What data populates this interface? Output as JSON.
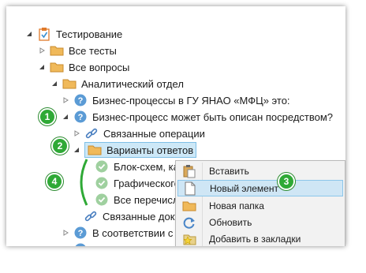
{
  "tree": [
    {
      "label": "Тестирование",
      "icon": "clipboard-check-icon",
      "arrow": "expanded"
    },
    {
      "label": "Все тесты",
      "icon": "folder-icon",
      "arrow": "collapsed"
    },
    {
      "label": "Все вопросы",
      "icon": "folder-icon",
      "arrow": "expanded"
    },
    {
      "label": "Аналитический отдел",
      "icon": "folder-icon",
      "arrow": "expanded"
    },
    {
      "label": "Бизнес-процессы в ГУ ЯНАО «МФЦ» это:",
      "icon": "question-icon",
      "arrow": "collapsed"
    },
    {
      "label": "Бизнес-процесс может быть описан посредством?",
      "icon": "question-icon",
      "arrow": "expanded"
    },
    {
      "label": "Связанные операции",
      "icon": "link-icon",
      "arrow": "collapsed"
    },
    {
      "label": "Варианты ответов",
      "icon": "folder-icon",
      "arrow": "expanded"
    },
    {
      "label": "Блок-схем, кар",
      "icon": "check-circle-icon",
      "arrow": "none"
    },
    {
      "label": "Графического",
      "icon": "check-circle-icon",
      "arrow": "none"
    },
    {
      "label": "Все перечисле",
      "icon": "check-circle-icon",
      "arrow": "none"
    },
    {
      "label": "Связанные докум",
      "icon": "link-icon",
      "arrow": "none"
    },
    {
      "label": "В соответствии с че",
      "icon": "question-icon",
      "arrow": "collapsed"
    },
    {
      "label": "",
      "icon": "question-icon",
      "arrow": "collapsed"
    }
  ],
  "context_menu": [
    {
      "label": "Вставить",
      "icon": "paste-icon"
    },
    {
      "label": "Новый элемент",
      "icon": "new-document-icon"
    },
    {
      "label": "Новая папка",
      "icon": "folder-icon"
    },
    {
      "label": "Обновить",
      "icon": "refresh-icon"
    },
    {
      "label": "Добавить в закладки",
      "icon": "bookmark-star-icon"
    }
  ],
  "badges": [
    "1",
    "2",
    "3",
    "4"
  ],
  "colors": {
    "badge": "#2fa936",
    "selection": "#cde8f7",
    "menu_highlight": "#cfe6f5",
    "question": "#5b9bd5",
    "folder": "#f0b95a"
  }
}
